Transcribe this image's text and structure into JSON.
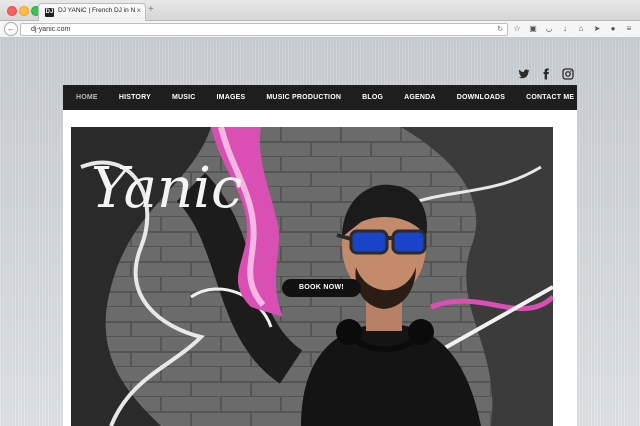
{
  "browser": {
    "tab_title": "DJ YANiC | French DJ in N...",
    "tab_favicon": "DJ",
    "url": "dj-yanic.com",
    "icons": [
      "back-icon",
      "reload-icon",
      "star-icon",
      "camera-icon",
      "pocket-icon",
      "download-icon",
      "home-icon",
      "send-icon",
      "chat-icon",
      "menu-icon"
    ]
  },
  "social": {
    "twitter": "twitter-icon",
    "facebook": "facebook-icon",
    "instagram": "instagram-icon"
  },
  "nav": {
    "items": [
      "HOME",
      "HISTORY",
      "MUSIC",
      "IMAGES",
      "MUSIC PRODUCTION",
      "BLOG",
      "AGENDA",
      "DOWNLOADS",
      "CONTACT ME"
    ],
    "active": "HOME"
  },
  "hero": {
    "logo_text": "Yanic",
    "cta_label": "BOOK NOW!"
  },
  "colors": {
    "nav_bg": "#1e1e1e",
    "accent_pink": "#d94fb3",
    "cta_bg": "#111111"
  }
}
